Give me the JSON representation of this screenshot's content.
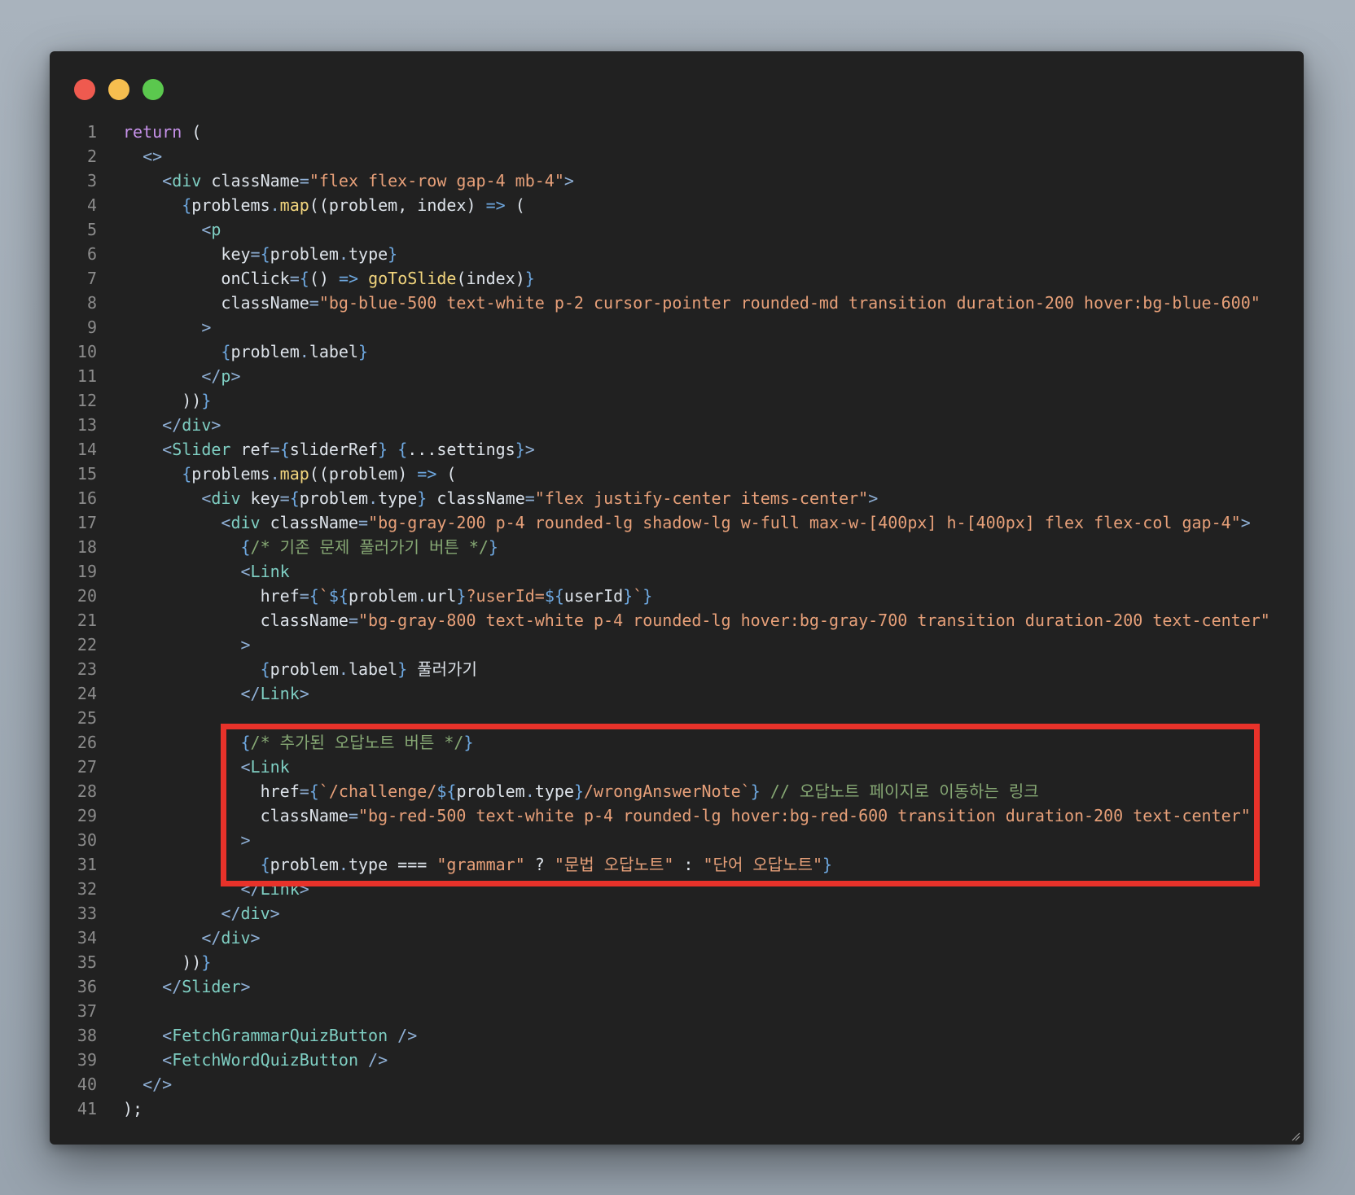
{
  "window": {
    "controls": [
      "close",
      "minimize",
      "maximize"
    ],
    "colors": {
      "close": "#ef5a4f",
      "minimize": "#f6be4f",
      "maximize": "#5bc84e"
    }
  },
  "code": {
    "lines": [
      {
        "n": "1",
        "indent": "",
        "tokens": [
          [
            "kw",
            "return"
          ],
          [
            "var",
            " ("
          ]
        ]
      },
      {
        "n": "2",
        "indent": "  ",
        "tokens": [
          [
            "punc",
            "<>"
          ]
        ]
      },
      {
        "n": "3",
        "indent": "    ",
        "tokens": [
          [
            "punc",
            "<"
          ],
          [
            "tag",
            "div"
          ],
          [
            "attr",
            " className"
          ],
          [
            "punc",
            "="
          ],
          [
            "str",
            "\"flex flex-row gap-4 mb-4\""
          ],
          [
            "punc",
            ">"
          ]
        ]
      },
      {
        "n": "4",
        "indent": "      ",
        "tokens": [
          [
            "brace",
            "{"
          ],
          [
            "var",
            "problems"
          ],
          [
            "punc",
            "."
          ],
          [
            "fn",
            "map"
          ],
          [
            "var",
            "(("
          ],
          [
            "var",
            "problem"
          ],
          [
            "var",
            ", "
          ],
          [
            "var",
            "index"
          ],
          [
            "var",
            ") "
          ],
          [
            "op",
            "=>"
          ],
          [
            "var",
            " ("
          ]
        ]
      },
      {
        "n": "5",
        "indent": "        ",
        "tokens": [
          [
            "punc",
            "<"
          ],
          [
            "tag",
            "p"
          ]
        ]
      },
      {
        "n": "6",
        "indent": "          ",
        "tokens": [
          [
            "attr",
            "key"
          ],
          [
            "punc",
            "="
          ],
          [
            "brace",
            "{"
          ],
          [
            "var",
            "problem"
          ],
          [
            "punc",
            "."
          ],
          [
            "var",
            "type"
          ],
          [
            "brace",
            "}"
          ]
        ]
      },
      {
        "n": "7",
        "indent": "          ",
        "tokens": [
          [
            "attr",
            "onClick"
          ],
          [
            "punc",
            "="
          ],
          [
            "brace",
            "{"
          ],
          [
            "var",
            "() "
          ],
          [
            "op",
            "=>"
          ],
          [
            "var",
            " "
          ],
          [
            "fn",
            "goToSlide"
          ],
          [
            "var",
            "(index)"
          ],
          [
            "brace",
            "}"
          ]
        ]
      },
      {
        "n": "8",
        "indent": "          ",
        "tokens": [
          [
            "attr",
            "className"
          ],
          [
            "punc",
            "="
          ],
          [
            "str",
            "\"bg-blue-500 text-white p-2 cursor-pointer rounded-md transition duration-200 hover:bg-blue-600\""
          ]
        ]
      },
      {
        "n": "9",
        "indent": "        ",
        "tokens": [
          [
            "punc",
            ">"
          ]
        ]
      },
      {
        "n": "10",
        "indent": "          ",
        "tokens": [
          [
            "brace",
            "{"
          ],
          [
            "var",
            "problem"
          ],
          [
            "punc",
            "."
          ],
          [
            "var",
            "label"
          ],
          [
            "brace",
            "}"
          ]
        ]
      },
      {
        "n": "11",
        "indent": "        ",
        "tokens": [
          [
            "punc",
            "</"
          ],
          [
            "tag",
            "p"
          ],
          [
            "punc",
            ">"
          ]
        ]
      },
      {
        "n": "12",
        "indent": "      ",
        "tokens": [
          [
            "var",
            "))"
          ],
          [
            "brace",
            "}"
          ]
        ]
      },
      {
        "n": "13",
        "indent": "    ",
        "tokens": [
          [
            "punc",
            "</"
          ],
          [
            "tag",
            "div"
          ],
          [
            "punc",
            ">"
          ]
        ]
      },
      {
        "n": "14",
        "indent": "    ",
        "tokens": [
          [
            "punc",
            "<"
          ],
          [
            "tag",
            "Slider"
          ],
          [
            "attr",
            " ref"
          ],
          [
            "punc",
            "="
          ],
          [
            "brace",
            "{"
          ],
          [
            "var",
            "sliderRef"
          ],
          [
            "brace",
            "}"
          ],
          [
            "var",
            " "
          ],
          [
            "brace",
            "{"
          ],
          [
            "var",
            "...settings"
          ],
          [
            "brace",
            "}"
          ],
          [
            "punc",
            ">"
          ]
        ]
      },
      {
        "n": "15",
        "indent": "      ",
        "tokens": [
          [
            "brace",
            "{"
          ],
          [
            "var",
            "problems"
          ],
          [
            "punc",
            "."
          ],
          [
            "fn",
            "map"
          ],
          [
            "var",
            "(("
          ],
          [
            "var",
            "problem"
          ],
          [
            "var",
            ") "
          ],
          [
            "op",
            "=>"
          ],
          [
            "var",
            " ("
          ]
        ]
      },
      {
        "n": "16",
        "indent": "        ",
        "tokens": [
          [
            "punc",
            "<"
          ],
          [
            "tag",
            "div"
          ],
          [
            "attr",
            " key"
          ],
          [
            "punc",
            "="
          ],
          [
            "brace",
            "{"
          ],
          [
            "var",
            "problem"
          ],
          [
            "punc",
            "."
          ],
          [
            "var",
            "type"
          ],
          [
            "brace",
            "}"
          ],
          [
            "attr",
            " className"
          ],
          [
            "punc",
            "="
          ],
          [
            "str",
            "\"flex justify-center items-center\""
          ],
          [
            "punc",
            ">"
          ]
        ]
      },
      {
        "n": "17",
        "indent": "          ",
        "tokens": [
          [
            "punc",
            "<"
          ],
          [
            "tag",
            "div"
          ],
          [
            "attr",
            " className"
          ],
          [
            "punc",
            "="
          ],
          [
            "str",
            "\"bg-gray-200 p-4 rounded-lg shadow-lg w-full max-w-[400px] h-[400px] flex flex-col gap-4\""
          ],
          [
            "punc",
            ">"
          ]
        ]
      },
      {
        "n": "18",
        "indent": "            ",
        "tokens": [
          [
            "brace",
            "{"
          ],
          [
            "cm",
            "/* 기존 문제 풀러가기 버튼 */"
          ],
          [
            "brace",
            "}"
          ]
        ]
      },
      {
        "n": "19",
        "indent": "            ",
        "tokens": [
          [
            "punc",
            "<"
          ],
          [
            "tag",
            "Link"
          ]
        ]
      },
      {
        "n": "20",
        "indent": "              ",
        "tokens": [
          [
            "attr",
            "href"
          ],
          [
            "punc",
            "="
          ],
          [
            "brace",
            "{"
          ],
          [
            "str",
            "`"
          ],
          [
            "brace",
            "${"
          ],
          [
            "var",
            "problem"
          ],
          [
            "punc",
            "."
          ],
          [
            "var",
            "url"
          ],
          [
            "brace",
            "}"
          ],
          [
            "str",
            "?userId="
          ],
          [
            "brace",
            "${"
          ],
          [
            "var",
            "userId"
          ],
          [
            "brace",
            "}"
          ],
          [
            "str",
            "`"
          ],
          [
            "brace",
            "}"
          ]
        ]
      },
      {
        "n": "21",
        "indent": "              ",
        "tokens": [
          [
            "attr",
            "className"
          ],
          [
            "punc",
            "="
          ],
          [
            "str",
            "\"bg-gray-800 text-white p-4 rounded-lg hover:bg-gray-700 transition duration-200 text-center\""
          ]
        ]
      },
      {
        "n": "22",
        "indent": "            ",
        "tokens": [
          [
            "punc",
            ">"
          ]
        ]
      },
      {
        "n": "23",
        "indent": "              ",
        "tokens": [
          [
            "brace",
            "{"
          ],
          [
            "var",
            "problem"
          ],
          [
            "punc",
            "."
          ],
          [
            "var",
            "label"
          ],
          [
            "brace",
            "}"
          ],
          [
            "var",
            " 풀러가기"
          ]
        ]
      },
      {
        "n": "24",
        "indent": "            ",
        "tokens": [
          [
            "punc",
            "</"
          ],
          [
            "tag",
            "Link"
          ],
          [
            "punc",
            ">"
          ]
        ]
      },
      {
        "n": "25",
        "indent": "",
        "tokens": []
      },
      {
        "n": "26",
        "indent": "            ",
        "tokens": [
          [
            "brace",
            "{"
          ],
          [
            "cm",
            "/* 추가된 오답노트 버튼 */"
          ],
          [
            "brace",
            "}"
          ]
        ]
      },
      {
        "n": "27",
        "indent": "            ",
        "tokens": [
          [
            "punc",
            "<"
          ],
          [
            "tag",
            "Link"
          ]
        ]
      },
      {
        "n": "28",
        "indent": "              ",
        "tokens": [
          [
            "attr",
            "href"
          ],
          [
            "punc",
            "="
          ],
          [
            "brace",
            "{"
          ],
          [
            "str",
            "`/challenge/"
          ],
          [
            "brace",
            "${"
          ],
          [
            "var",
            "problem"
          ],
          [
            "punc",
            "."
          ],
          [
            "var",
            "type"
          ],
          [
            "brace",
            "}"
          ],
          [
            "str",
            "/wrongAnswerNote`"
          ],
          [
            "brace",
            "}"
          ],
          [
            "cm",
            " // 오답노트 페이지로 이동하는 링크"
          ]
        ]
      },
      {
        "n": "29",
        "indent": "              ",
        "tokens": [
          [
            "attr",
            "className"
          ],
          [
            "punc",
            "="
          ],
          [
            "str",
            "\"bg-red-500 text-white p-4 rounded-lg hover:bg-red-600 transition duration-200 text-center\""
          ]
        ]
      },
      {
        "n": "30",
        "indent": "            ",
        "tokens": [
          [
            "punc",
            ">"
          ]
        ]
      },
      {
        "n": "31",
        "indent": "              ",
        "tokens": [
          [
            "brace",
            "{"
          ],
          [
            "var",
            "problem"
          ],
          [
            "punc",
            "."
          ],
          [
            "var",
            "type"
          ],
          [
            "var",
            " === "
          ],
          [
            "str",
            "\"grammar\""
          ],
          [
            "var",
            " ? "
          ],
          [
            "str",
            "\"문법 오답노트\""
          ],
          [
            "var",
            " : "
          ],
          [
            "str",
            "\"단어 오답노트\""
          ],
          [
            "brace",
            "}"
          ]
        ]
      },
      {
        "n": "32",
        "indent": "            ",
        "tokens": [
          [
            "punc",
            "</"
          ],
          [
            "tag",
            "Link"
          ],
          [
            "punc",
            ">"
          ]
        ]
      },
      {
        "n": "33",
        "indent": "          ",
        "tokens": [
          [
            "punc",
            "</"
          ],
          [
            "tag",
            "div"
          ],
          [
            "punc",
            ">"
          ]
        ]
      },
      {
        "n": "34",
        "indent": "        ",
        "tokens": [
          [
            "punc",
            "</"
          ],
          [
            "tag",
            "div"
          ],
          [
            "punc",
            ">"
          ]
        ]
      },
      {
        "n": "35",
        "indent": "      ",
        "tokens": [
          [
            "var",
            "))"
          ],
          [
            "brace",
            "}"
          ]
        ]
      },
      {
        "n": "36",
        "indent": "    ",
        "tokens": [
          [
            "punc",
            "</"
          ],
          [
            "tag",
            "Slider"
          ],
          [
            "punc",
            ">"
          ]
        ]
      },
      {
        "n": "37",
        "indent": "",
        "tokens": []
      },
      {
        "n": "38",
        "indent": "    ",
        "tokens": [
          [
            "punc",
            "<"
          ],
          [
            "tag",
            "FetchGrammarQuizButton"
          ],
          [
            "punc",
            " />"
          ]
        ]
      },
      {
        "n": "39",
        "indent": "    ",
        "tokens": [
          [
            "punc",
            "<"
          ],
          [
            "tag",
            "FetchWordQuizButton"
          ],
          [
            "punc",
            " />"
          ]
        ]
      },
      {
        "n": "40",
        "indent": "  ",
        "tokens": [
          [
            "punc",
            "</>"
          ]
        ]
      },
      {
        "n": "41",
        "indent": "",
        "tokens": [
          [
            "var",
            ");"
          ]
        ]
      }
    ]
  },
  "highlight": {
    "color": "#e8322a",
    "from_line": "26",
    "to_line": "32"
  }
}
